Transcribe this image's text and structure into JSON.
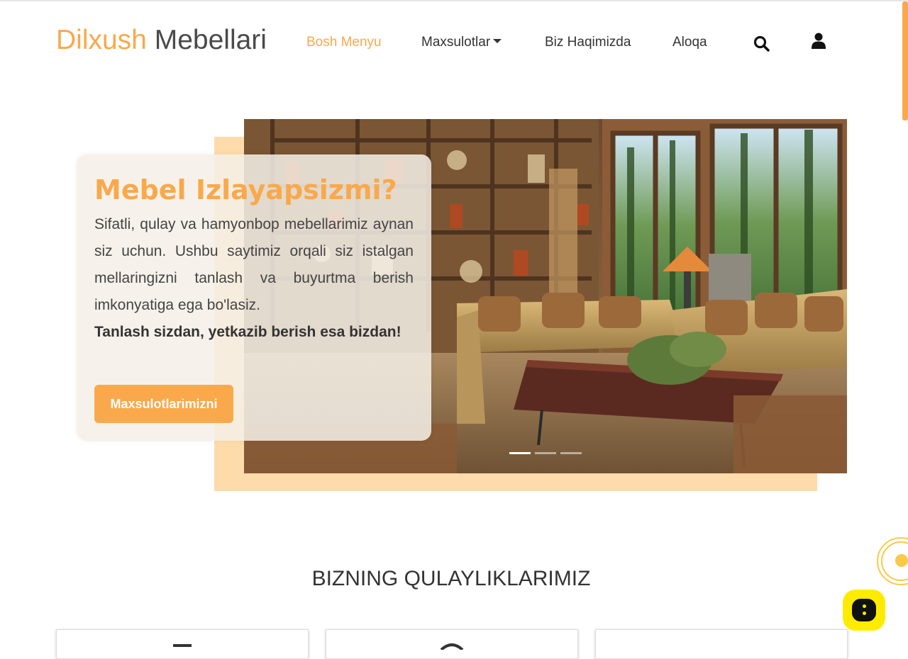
{
  "brand": {
    "part1": "Dilxush",
    "part2": "Mebellari"
  },
  "nav": {
    "items": [
      {
        "label": "Bosh Menyu",
        "active": true
      },
      {
        "label": "Maxsulotlar",
        "dropdown": true
      },
      {
        "label": "Biz Haqimizda"
      },
      {
        "label": "Aloqa"
      }
    ],
    "icons": [
      "search-icon",
      "user-icon"
    ]
  },
  "hero": {
    "title": "Mebel Izlayapsizmi?",
    "description": "Sifatli, qulay va hamyonbop mebellarimiz aynan siz uchun. Ushbu saytimiz orqali siz istalgan mellaringizni tanlash va buyurtma berish imkonyatiga ega bo'lasiz.",
    "slogan": "Tanlash sizdan, yetkazib berish esa bizdan!",
    "button": "Maxsulotlarimizni",
    "slides": 3,
    "active_slide": 1
  },
  "section": {
    "title": "BIZNING QULAYLIKLARIMIZ"
  },
  "features": {
    "count": 3
  },
  "widgets": {
    "chat": "chat-icon",
    "call": "call-widget-icon"
  },
  "colors": {
    "accent": "#f9a94b",
    "hero_back": "#fedbaa",
    "chat": "#ffeb00",
    "text": "#333333"
  }
}
